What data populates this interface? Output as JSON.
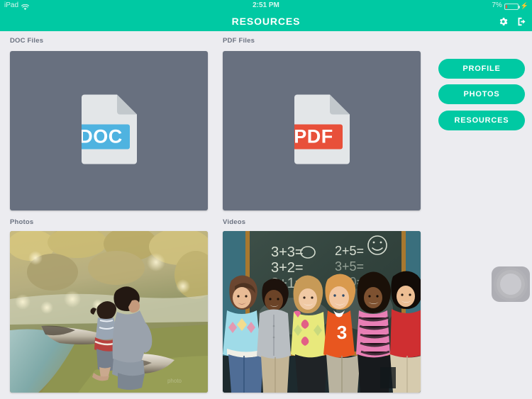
{
  "statusbar": {
    "device": "iPad",
    "wifi_icon": "wifi-icon",
    "time": "2:51 PM",
    "battery_percent": "7%",
    "battery_icon": "battery-icon",
    "charging_icon": "lightning-bolt-icon"
  },
  "navbar": {
    "title": "RESOURCES",
    "settings_icon": "gear-icon",
    "logout_icon": "logout-icon"
  },
  "sections": {
    "doc_files": "DOC Files",
    "pdf_files": "PDF Files",
    "photos": "Photos",
    "videos": "Videos"
  },
  "doc_card": {
    "icon_name": "doc-file-icon",
    "label": "DOC",
    "label_color": "#4fb3e0",
    "page_color": "#e3e6e8"
  },
  "pdf_card": {
    "icon_name": "pdf-file-icon",
    "label": "PDF",
    "label_color": "#e8503a",
    "page_color": "#e3e6e8"
  },
  "buttons": [
    {
      "label": "PROFILE",
      "name": "profile-button"
    },
    {
      "label": "PHOTOS",
      "name": "photos-button"
    },
    {
      "label": "RESOURCES",
      "name": "resources-button"
    }
  ],
  "photo_thumb": {
    "alt": "Two children sitting on a fallen log beside a pond in autumn"
  },
  "video_thumb": {
    "alt": "Six schoolchildren standing arm in arm in front of a chalkboard",
    "chalkboard_lines": [
      "3+3=",
      "3+2=",
      "3+1=",
      "2+5=",
      "3+5=",
      "3+0="
    ],
    "jersey_number": "3"
  },
  "assistive_touch": {
    "name": "assistive-touch-button"
  },
  "theme": {
    "accent": "#00c9a3",
    "background": "#ececf0",
    "card": "#68707f",
    "label_text": "#6b7280"
  }
}
